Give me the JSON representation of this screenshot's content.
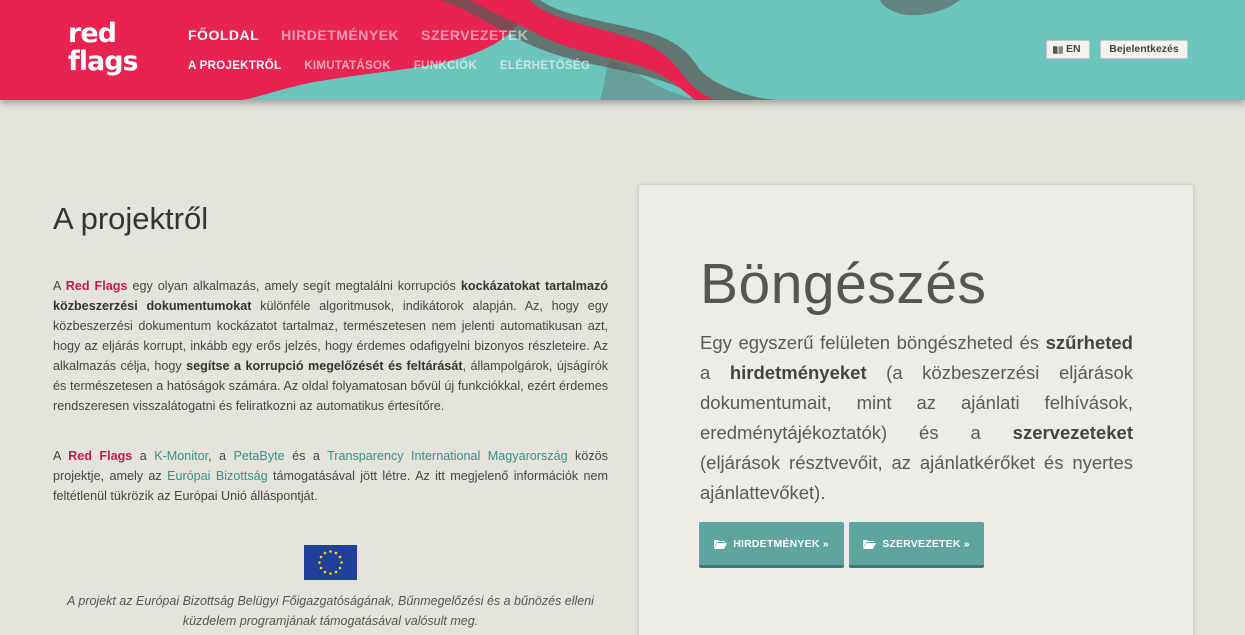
{
  "header": {
    "logo": {
      "line1": "red",
      "line2": "flags"
    },
    "nav_main": [
      {
        "label": "FŐOLDAL",
        "active": true
      },
      {
        "label": "HIRDETMÉNYEK",
        "active": false
      },
      {
        "label": "SZERVEZETEK",
        "active": false
      }
    ],
    "nav_sub": [
      {
        "label": "A PROJEKTRŐL",
        "active": true
      },
      {
        "label": "KIMUTATÁSOK",
        "active": false
      },
      {
        "label": "FUNKCIÓK",
        "active": false
      },
      {
        "label": "ELÉRHETŐSÉG",
        "active": false
      }
    ],
    "lang_button": {
      "label": "EN",
      "icon": "book-icon"
    },
    "login_button": {
      "label": "Bejelentkezés"
    }
  },
  "about": {
    "title": "A projektről",
    "p1": {
      "t1": "A ",
      "redflags": "Red Flags",
      "t2": " egy olyan alkalmazás, amely segít megtalálni korrupciós ",
      "b1": "kockázatokat tartalmazó közbeszerzési dokumentumokat",
      "t3": " különféle algoritmusok, indikátorok alapján. Az, hogy egy közbeszerzési dokumentum kockázatot tartalmaz, természetesen nem jelenti automatikusan azt, hogy az eljárás korrupt, inkább egy erős jelzés, hogy érdemes odafigyelni bizonyos részleteire. Az alkalmazás célja, hogy ",
      "b2": "segítse a korrupció megelőzését és feltárását",
      "t4": ", állampolgárok, újságírók és természetesen a hatóságok számára. Az oldal folyamatosan bővül új funkciókkal, ezért érdemes rendszeresen visszalátogatni és feliratkozni az automatikus értesítőre."
    },
    "p2": {
      "t1": "A ",
      "redflags": "Red Flags",
      "t2": " a ",
      "l1": "K-Monitor",
      "t3": ", a ",
      "l2": "PetaByte",
      "t4": " és a ",
      "l3": "Transparency International Magyarország",
      "t5": " közös projektje, amely az ",
      "l4": "Európai Bizottság",
      "t6": " támogatásával jött létre. Az itt megjelenő információk nem feltétlenül tükrözik az Európai Unió álláspontját."
    },
    "eu_note": "A projekt az Európai Bizottság Belügyi Főigazgatóságának, Bűnmegelőzési és a bűnözés elleni küzdelem programjának támogatásával valósult meg."
  },
  "browse": {
    "title": "Böngészés",
    "t1": "Egy egyszerű felületen böngészheted és ",
    "b1": "szűrheted",
    "t2": " a ",
    "b2": "hirdetményeket",
    "t3": " (a közbeszerzési eljárások dokumentumait, mint az ajánlati felhívások, eredménytájékoztatók) és a ",
    "b3": "szervezeteket",
    "t4": " (eljárások résztvevőit, az ajánlatkérőket és nyertes ajánlattevőket).",
    "button_ads": "HIRDETMÉNYEK »",
    "button_orgs": "SZERVEZETEK »"
  },
  "colors": {
    "brand_red": "#e8234f",
    "teal": "#6cc5bd",
    "button_teal": "#5ea5a0",
    "link": "#3a8f8a"
  }
}
